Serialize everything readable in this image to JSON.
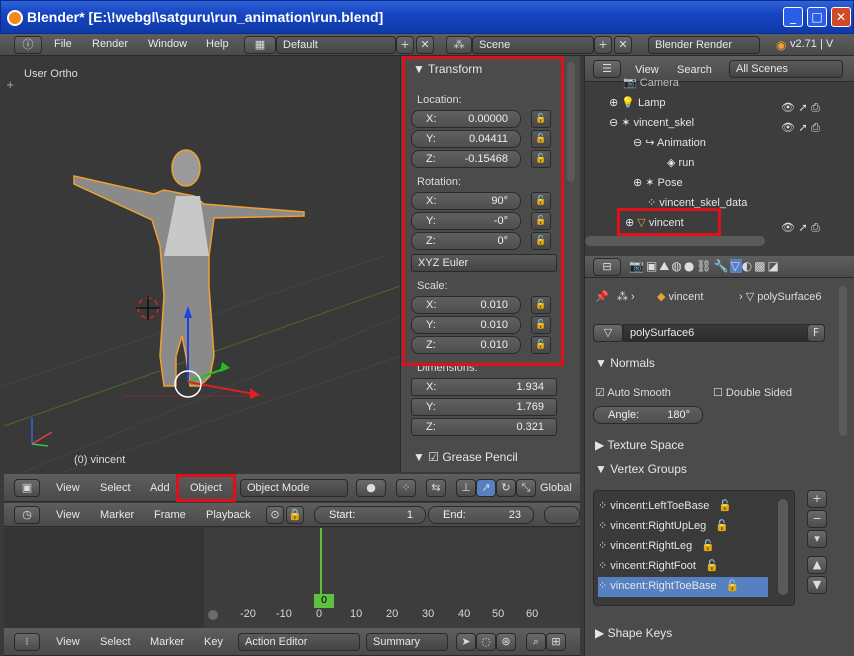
{
  "window": {
    "title": "Blender* [E:\\!webgl\\satguru\\run_animation\\run.blend]"
  },
  "topbar": {
    "menus": [
      "File",
      "Render",
      "Window",
      "Help"
    ],
    "screen_layout": "Default",
    "scene": "Scene",
    "render_engine": "Blender Render",
    "version": "v2.71 | V"
  },
  "viewport": {
    "view_label": "User Ortho",
    "object_label": "(0) vincent"
  },
  "transform_panel": {
    "title": "Transform",
    "location_label": "Location:",
    "location": [
      {
        "k": "X:",
        "v": "0.00000"
      },
      {
        "k": "Y:",
        "v": "0.04411"
      },
      {
        "k": "Z:",
        "v": "-0.15468"
      }
    ],
    "rotation_label": "Rotation:",
    "rotation": [
      {
        "k": "X:",
        "v": "90°"
      },
      {
        "k": "Y:",
        "v": "-0°"
      },
      {
        "k": "Z:",
        "v": "0°"
      }
    ],
    "rotation_mode": "XYZ Euler",
    "scale_label": "Scale:",
    "scale": [
      {
        "k": "X:",
        "v": "0.010"
      },
      {
        "k": "Y:",
        "v": "0.010"
      },
      {
        "k": "Z:",
        "v": "0.010"
      }
    ],
    "dimensions_label": "Dimensions:",
    "dimensions": [
      {
        "k": "X:",
        "v": "1.934"
      },
      {
        "k": "Y:",
        "v": "1.769"
      },
      {
        "k": "Z:",
        "v": "0.321"
      }
    ],
    "grease_pencil": "Grease Pencil"
  },
  "viewport_header": {
    "menus": [
      "View",
      "Select",
      "Add",
      "Object"
    ],
    "mode": "Object Mode",
    "orientation": "Global"
  },
  "timeline_header": {
    "menus": [
      "View",
      "Marker",
      "Frame",
      "Playback"
    ],
    "start_label": "Start:",
    "start": "1",
    "end_label": "End:",
    "end": "23"
  },
  "timeline": {
    "ticks": [
      "-20",
      "-10",
      "0",
      "10",
      "20",
      "30",
      "40",
      "50",
      "60"
    ],
    "current_frame": "0"
  },
  "action_header": {
    "menus": [
      "View",
      "Select",
      "Marker",
      "Key"
    ],
    "editor": "Action Editor",
    "summary": "Summary"
  },
  "outliner": {
    "menus": [
      "View",
      "Search"
    ],
    "filter": "All Scenes",
    "rows": [
      "Camera",
      "Lamp",
      "vincent_skel",
      "Animation",
      "run",
      "Pose",
      "vincent_skel_data",
      "vincent"
    ]
  },
  "properties": {
    "breadcrumb_object": "vincent",
    "breadcrumb_mesh": "polySurface6",
    "mesh_name": "polySurface6",
    "fake_user": "F",
    "normals": "Normals",
    "auto_smooth": "Auto Smooth",
    "double_sided": "Double Sided",
    "angle_label": "Angle:",
    "angle": "180°",
    "texture_space": "Texture Space",
    "vertex_groups": "Vertex Groups",
    "groups": [
      "vincent:LeftToeBase",
      "vincent:RightUpLeg",
      "vincent:RightLeg",
      "vincent:RightFoot",
      "vincent:RightToeBase"
    ],
    "shape_keys": "Shape Keys"
  },
  "colors": {
    "accent_blue": "#5680c2",
    "highlight": "#e0101a",
    "selection_orange": "#f0a030"
  }
}
